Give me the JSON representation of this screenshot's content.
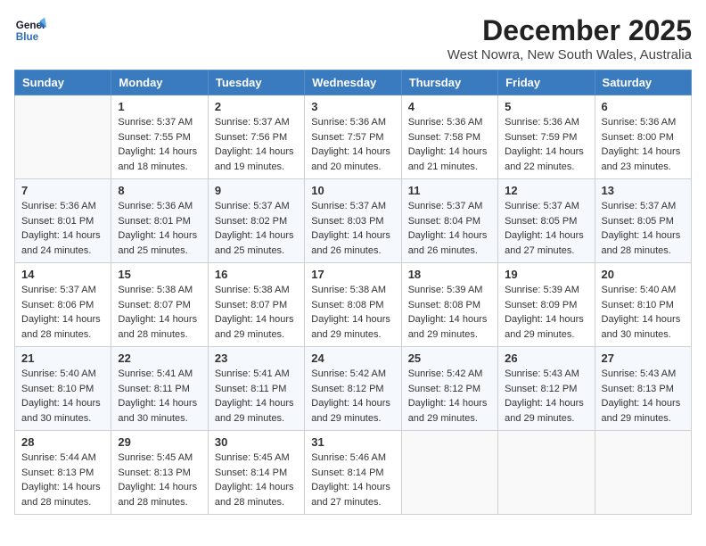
{
  "header": {
    "logo_line1": "General",
    "logo_line2": "Blue",
    "month_title": "December 2025",
    "subtitle": "West Nowra, New South Wales, Australia"
  },
  "days_of_week": [
    "Sunday",
    "Monday",
    "Tuesday",
    "Wednesday",
    "Thursday",
    "Friday",
    "Saturday"
  ],
  "weeks": [
    [
      {
        "day": "",
        "info": ""
      },
      {
        "day": "1",
        "info": "Sunrise: 5:37 AM\nSunset: 7:55 PM\nDaylight: 14 hours\nand 18 minutes."
      },
      {
        "day": "2",
        "info": "Sunrise: 5:37 AM\nSunset: 7:56 PM\nDaylight: 14 hours\nand 19 minutes."
      },
      {
        "day": "3",
        "info": "Sunrise: 5:36 AM\nSunset: 7:57 PM\nDaylight: 14 hours\nand 20 minutes."
      },
      {
        "day": "4",
        "info": "Sunrise: 5:36 AM\nSunset: 7:58 PM\nDaylight: 14 hours\nand 21 minutes."
      },
      {
        "day": "5",
        "info": "Sunrise: 5:36 AM\nSunset: 7:59 PM\nDaylight: 14 hours\nand 22 minutes."
      },
      {
        "day": "6",
        "info": "Sunrise: 5:36 AM\nSunset: 8:00 PM\nDaylight: 14 hours\nand 23 minutes."
      }
    ],
    [
      {
        "day": "7",
        "info": "Sunrise: 5:36 AM\nSunset: 8:01 PM\nDaylight: 14 hours\nand 24 minutes."
      },
      {
        "day": "8",
        "info": "Sunrise: 5:36 AM\nSunset: 8:01 PM\nDaylight: 14 hours\nand 25 minutes."
      },
      {
        "day": "9",
        "info": "Sunrise: 5:37 AM\nSunset: 8:02 PM\nDaylight: 14 hours\nand 25 minutes."
      },
      {
        "day": "10",
        "info": "Sunrise: 5:37 AM\nSunset: 8:03 PM\nDaylight: 14 hours\nand 26 minutes."
      },
      {
        "day": "11",
        "info": "Sunrise: 5:37 AM\nSunset: 8:04 PM\nDaylight: 14 hours\nand 26 minutes."
      },
      {
        "day": "12",
        "info": "Sunrise: 5:37 AM\nSunset: 8:05 PM\nDaylight: 14 hours\nand 27 minutes."
      },
      {
        "day": "13",
        "info": "Sunrise: 5:37 AM\nSunset: 8:05 PM\nDaylight: 14 hours\nand 28 minutes."
      }
    ],
    [
      {
        "day": "14",
        "info": "Sunrise: 5:37 AM\nSunset: 8:06 PM\nDaylight: 14 hours\nand 28 minutes."
      },
      {
        "day": "15",
        "info": "Sunrise: 5:38 AM\nSunset: 8:07 PM\nDaylight: 14 hours\nand 28 minutes."
      },
      {
        "day": "16",
        "info": "Sunrise: 5:38 AM\nSunset: 8:07 PM\nDaylight: 14 hours\nand 29 minutes."
      },
      {
        "day": "17",
        "info": "Sunrise: 5:38 AM\nSunset: 8:08 PM\nDaylight: 14 hours\nand 29 minutes."
      },
      {
        "day": "18",
        "info": "Sunrise: 5:39 AM\nSunset: 8:08 PM\nDaylight: 14 hours\nand 29 minutes."
      },
      {
        "day": "19",
        "info": "Sunrise: 5:39 AM\nSunset: 8:09 PM\nDaylight: 14 hours\nand 29 minutes."
      },
      {
        "day": "20",
        "info": "Sunrise: 5:40 AM\nSunset: 8:10 PM\nDaylight: 14 hours\nand 30 minutes."
      }
    ],
    [
      {
        "day": "21",
        "info": "Sunrise: 5:40 AM\nSunset: 8:10 PM\nDaylight: 14 hours\nand 30 minutes."
      },
      {
        "day": "22",
        "info": "Sunrise: 5:41 AM\nSunset: 8:11 PM\nDaylight: 14 hours\nand 30 minutes."
      },
      {
        "day": "23",
        "info": "Sunrise: 5:41 AM\nSunset: 8:11 PM\nDaylight: 14 hours\nand 29 minutes."
      },
      {
        "day": "24",
        "info": "Sunrise: 5:42 AM\nSunset: 8:12 PM\nDaylight: 14 hours\nand 29 minutes."
      },
      {
        "day": "25",
        "info": "Sunrise: 5:42 AM\nSunset: 8:12 PM\nDaylight: 14 hours\nand 29 minutes."
      },
      {
        "day": "26",
        "info": "Sunrise: 5:43 AM\nSunset: 8:12 PM\nDaylight: 14 hours\nand 29 minutes."
      },
      {
        "day": "27",
        "info": "Sunrise: 5:43 AM\nSunset: 8:13 PM\nDaylight: 14 hours\nand 29 minutes."
      }
    ],
    [
      {
        "day": "28",
        "info": "Sunrise: 5:44 AM\nSunset: 8:13 PM\nDaylight: 14 hours\nand 28 minutes."
      },
      {
        "day": "29",
        "info": "Sunrise: 5:45 AM\nSunset: 8:13 PM\nDaylight: 14 hours\nand 28 minutes."
      },
      {
        "day": "30",
        "info": "Sunrise: 5:45 AM\nSunset: 8:14 PM\nDaylight: 14 hours\nand 28 minutes."
      },
      {
        "day": "31",
        "info": "Sunrise: 5:46 AM\nSunset: 8:14 PM\nDaylight: 14 hours\nand 27 minutes."
      },
      {
        "day": "",
        "info": ""
      },
      {
        "day": "",
        "info": ""
      },
      {
        "day": "",
        "info": ""
      }
    ]
  ]
}
